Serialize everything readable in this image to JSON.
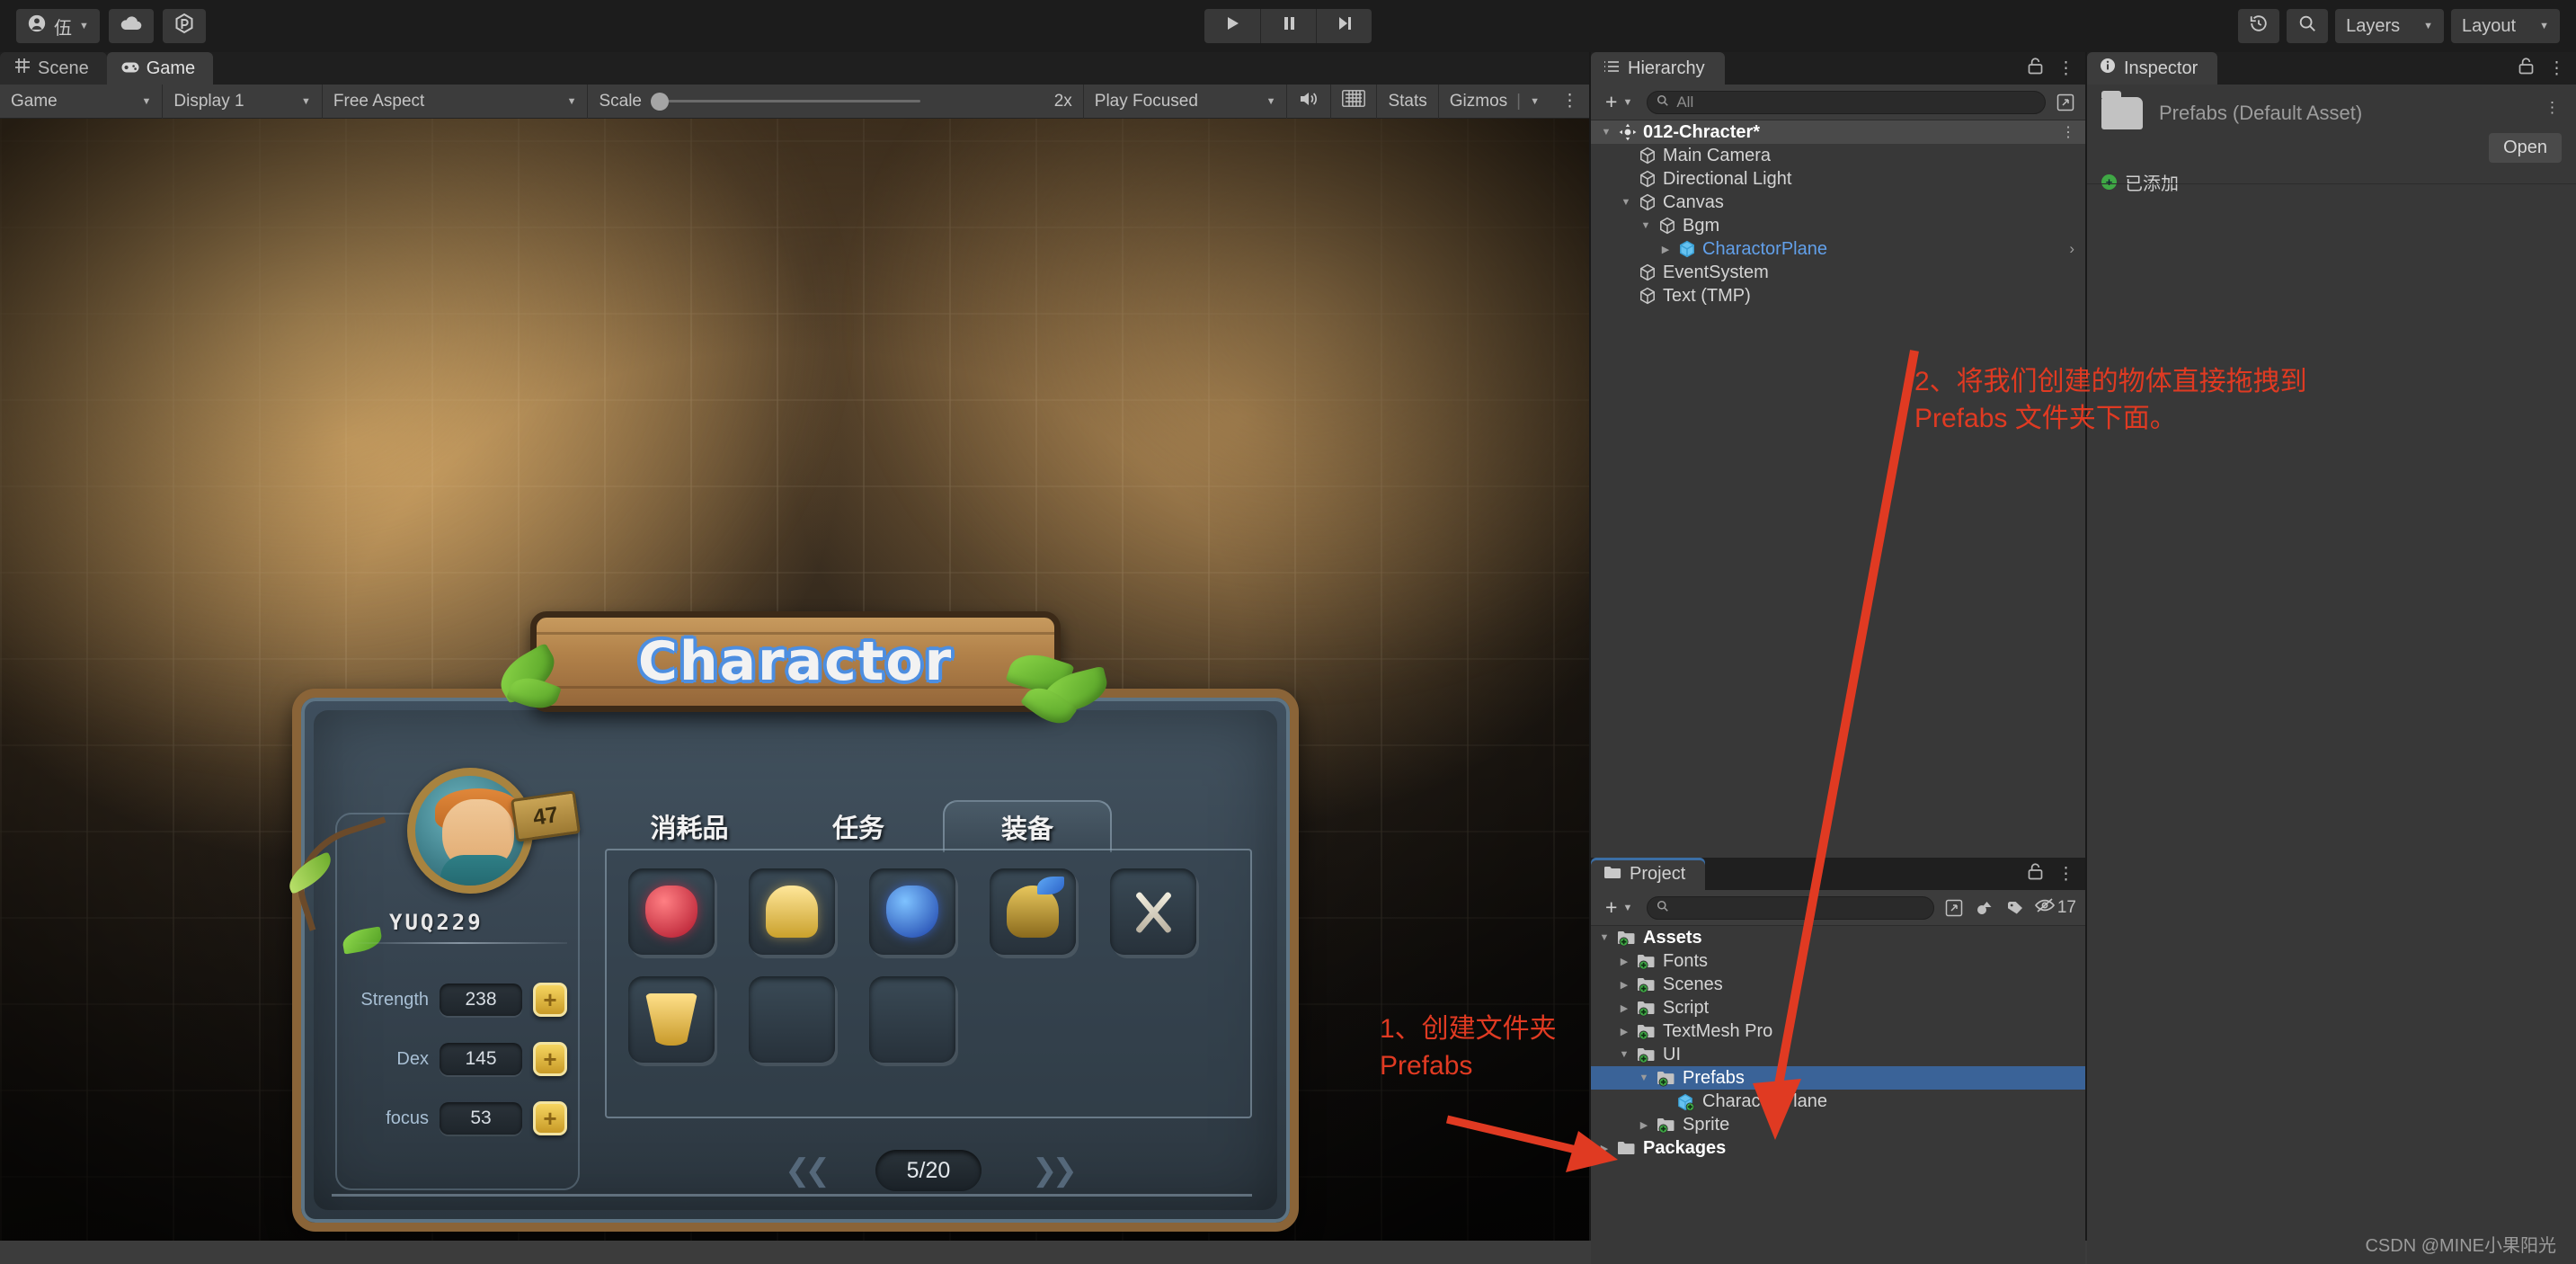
{
  "toolbar": {
    "account_label": "伍",
    "account_icon": "user-circle-icon",
    "cloud_icon": "cloud-icon",
    "services_icon": "unity-services-icon",
    "play_icon": "play-icon",
    "pause_icon": "pause-icon",
    "step_icon": "step-forward-icon",
    "history_icon": "undo-history-icon",
    "search_icon": "search-icon",
    "layers_label": "Layers",
    "layout_label": "Layout",
    "caret": "▼"
  },
  "view_tabs": [
    {
      "label": "Scene",
      "icon": "scene-grid-icon",
      "active": false
    },
    {
      "label": "Game",
      "icon": "gamepad-icon",
      "active": true
    }
  ],
  "game_toolbar": {
    "view_select": "Game",
    "display_select": "Display 1",
    "aspect_select": "Free Aspect",
    "scale_label": "Scale",
    "scale_value": "2x",
    "play_mode_select": "Play Focused",
    "mute_icon": "speaker-icon",
    "stats_toggle_icon": "keyboard-icon",
    "stats_label": "Stats",
    "gizmos_label": "Gizmos"
  },
  "game_ui": {
    "board_title": "Charactor",
    "level": "47",
    "player_name": "YUQ229",
    "stats": [
      {
        "label": "Strength",
        "value": "238",
        "button": "+"
      },
      {
        "label": "Dex",
        "value": "145",
        "button": "+"
      },
      {
        "label": "focus",
        "value": "53",
        "button": "+"
      }
    ],
    "inventory_tabs": [
      {
        "label": "消耗品",
        "active": false
      },
      {
        "label": "任务",
        "active": false
      },
      {
        "label": "装备",
        "active": true
      }
    ],
    "slots": [
      {
        "item": "potion-red"
      },
      {
        "item": "gold"
      },
      {
        "item": "potion-blue"
      },
      {
        "item": "helmet"
      },
      {
        "item": "swords"
      },
      {
        "item": "armor"
      },
      {
        "item": ""
      },
      {
        "item": ""
      }
    ],
    "page_indicator": "5/20",
    "page_prev_icon": "ornament-left-icon",
    "page_next_icon": "ornament-right-icon"
  },
  "hierarchy": {
    "tab_label": "Hierarchy",
    "tab_icon": "hierarchy-list-icon",
    "lock_icon": "lock-open-icon",
    "menu_icon": "kebab-menu-icon",
    "add_icon": "plus-icon",
    "search_placeholder": "All",
    "search_value": "",
    "expand_icon": "expand-window-icon",
    "items": [
      {
        "label": "012-Chracter*",
        "depth": 0,
        "arrow": "▼",
        "icon": "scene-icon",
        "style": "root"
      },
      {
        "label": "Main Camera",
        "depth": 1,
        "arrow": "",
        "icon": "cube-icon",
        "style": "normal"
      },
      {
        "label": "Directional Light",
        "depth": 1,
        "arrow": "",
        "icon": "cube-icon",
        "style": "normal"
      },
      {
        "label": "Canvas",
        "depth": 1,
        "arrow": "▼",
        "icon": "cube-icon",
        "style": "normal"
      },
      {
        "label": "Bgm",
        "depth": 2,
        "arrow": "▼",
        "icon": "cube-icon",
        "style": "normal"
      },
      {
        "label": "CharactorPlane",
        "depth": 3,
        "arrow": "▶",
        "icon": "prefab-cube-icon",
        "style": "prefab"
      },
      {
        "label": "EventSystem",
        "depth": 1,
        "arrow": "",
        "icon": "cube-icon",
        "style": "normal"
      },
      {
        "label": "Text (TMP)",
        "depth": 1,
        "arrow": "",
        "icon": "cube-icon",
        "style": "normal"
      }
    ]
  },
  "project": {
    "tab_label": "Project",
    "tab_icon": "folder-icon",
    "lock_icon": "lock-open-icon",
    "menu_icon": "kebab-menu-icon",
    "add_icon": "plus-icon",
    "search_placeholder": "",
    "search_value": "",
    "expand_icon": "expand-window-icon",
    "type_filter_icon": "asset-type-filter-icon",
    "label_filter_icon": "label-tag-icon",
    "hidden_count_icon": "eye-off-icon",
    "hidden_count": "17",
    "items": [
      {
        "label": "Assets",
        "depth": 0,
        "arrow": "▼",
        "icon": "folder-plus-icon",
        "bold": true,
        "selected": false
      },
      {
        "label": "Fonts",
        "depth": 1,
        "arrow": "▶",
        "icon": "folder-plus-icon",
        "bold": false,
        "selected": false
      },
      {
        "label": "Scenes",
        "depth": 1,
        "arrow": "▶",
        "icon": "folder-plus-icon",
        "bold": false,
        "selected": false
      },
      {
        "label": "Script",
        "depth": 1,
        "arrow": "▶",
        "icon": "folder-plus-icon",
        "bold": false,
        "selected": false
      },
      {
        "label": "TextMesh Pro",
        "depth": 1,
        "arrow": "▶",
        "icon": "folder-plus-icon",
        "bold": false,
        "selected": false
      },
      {
        "label": "UI",
        "depth": 1,
        "arrow": "▼",
        "icon": "folder-plus-icon",
        "bold": false,
        "selected": false
      },
      {
        "label": "Prefabs",
        "depth": 2,
        "arrow": "▼",
        "icon": "folder-plus-icon",
        "bold": false,
        "selected": true
      },
      {
        "label": "CharactorPlane",
        "depth": 3,
        "arrow": "",
        "icon": "prefab-cube-icon",
        "bold": false,
        "selected": false
      },
      {
        "label": "Sprite",
        "depth": 2,
        "arrow": "▶",
        "icon": "folder-plus-icon",
        "bold": false,
        "selected": false
      },
      {
        "label": "Packages",
        "depth": 0,
        "arrow": "▶",
        "icon": "folder-icon",
        "bold": true,
        "selected": false
      }
    ]
  },
  "inspector": {
    "tab_label": "Inspector",
    "tab_icon": "info-circle-icon",
    "lock_icon": "lock-open-icon",
    "menu_icon": "kebab-menu-icon",
    "asset_title": "Prefabs (Default Asset)",
    "folder_icon": "folder-large-icon",
    "open_button": "Open",
    "added_label": "已添加",
    "added_icon": "green-plus-icon"
  },
  "annotations": {
    "note1": "1、创建文件夹\nPrefabs",
    "note2": "2、将我们创建的物体直接拖拽到\nPrefabs 文件夹下面。",
    "color": "#e03a22"
  },
  "watermark": "CSDN @MINE小果阳光"
}
